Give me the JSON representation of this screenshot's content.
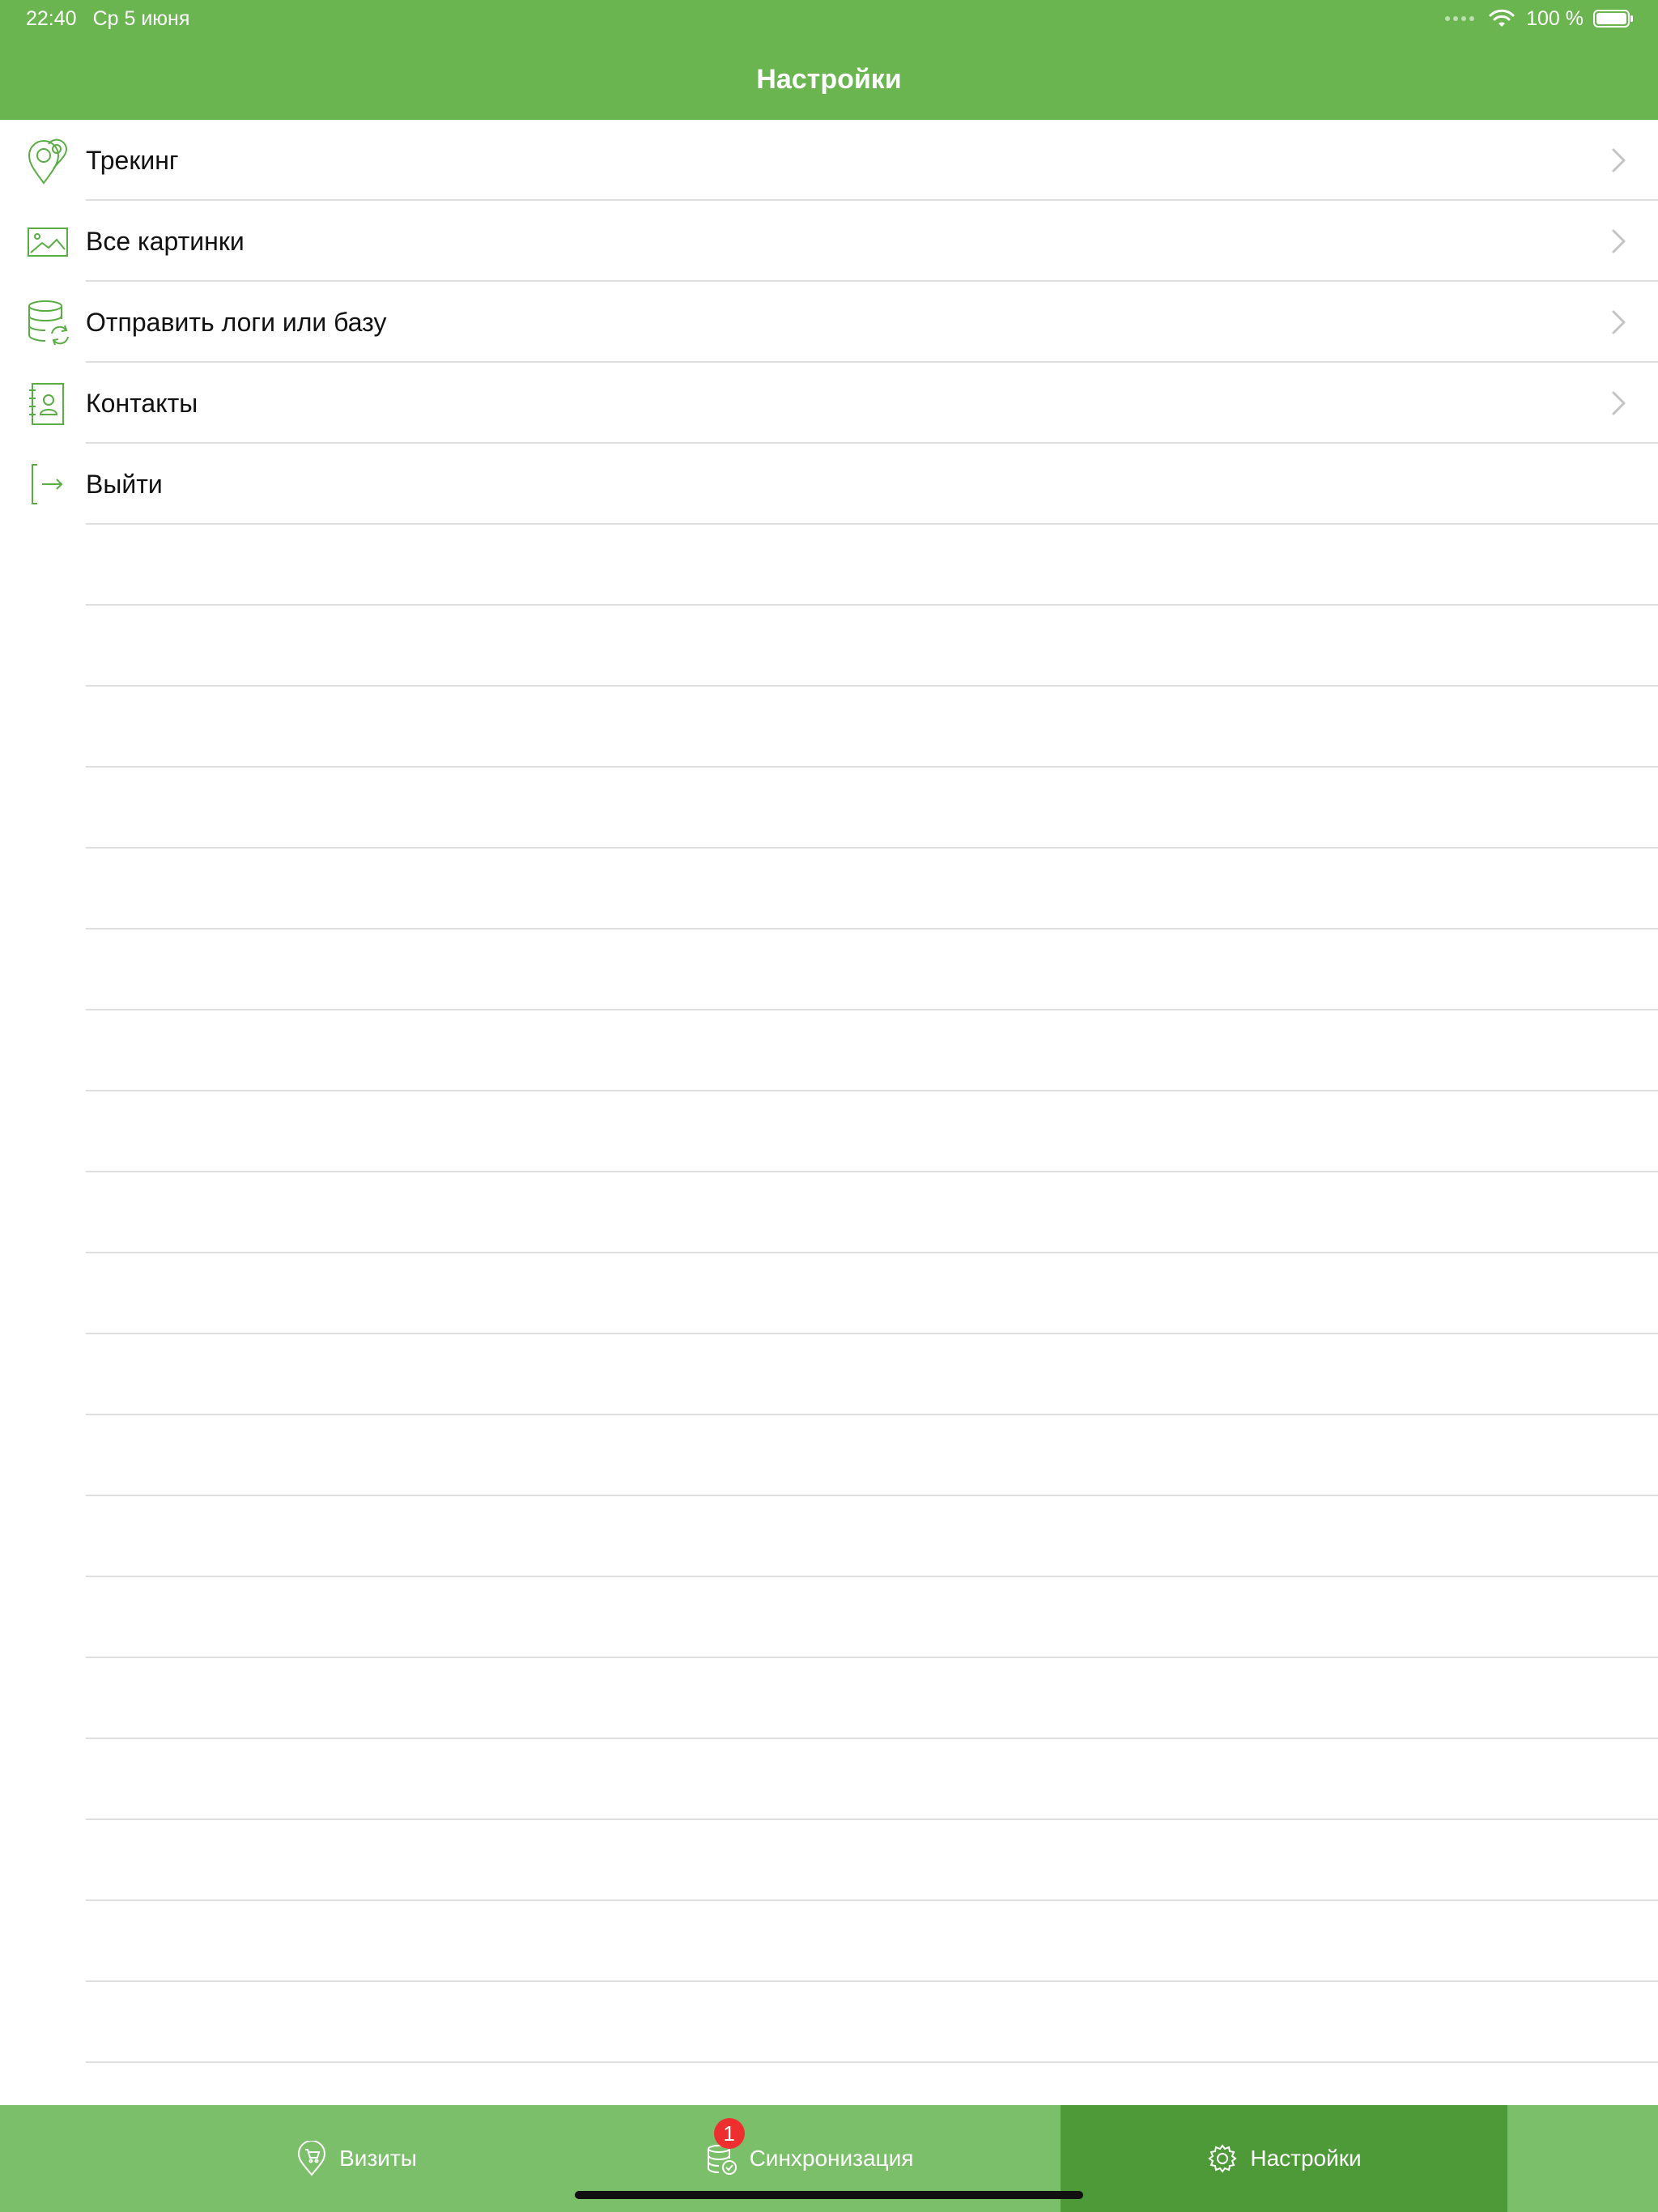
{
  "status_bar": {
    "time": "22:40",
    "date": "Ср 5 июня",
    "battery": "100 %"
  },
  "header": {
    "title": "Настройки"
  },
  "settings": {
    "items": [
      {
        "label": "Трекинг",
        "icon": "location-pins-icon"
      },
      {
        "label": "Все картинки",
        "icon": "image-icon"
      },
      {
        "label": "Отправить логи или базу",
        "icon": "database-sync-icon"
      },
      {
        "label": "Контакты",
        "icon": "contacts-book-icon"
      },
      {
        "label": "Выйти",
        "icon": "logout-icon"
      }
    ]
  },
  "tabbar": {
    "tabs": [
      {
        "label": "Визиты",
        "icon": "map-pin-cart-icon"
      },
      {
        "label": "Синхронизация",
        "icon": "database-check-icon",
        "badge": "1"
      },
      {
        "label": "Настройки",
        "icon": "gear-icon"
      }
    ]
  },
  "colors": {
    "header": "#6ab550",
    "tabbar": "#7cbf6a",
    "tab_active": "#4f9a38",
    "icon_green": "#5aad45",
    "badge": "#ee2f2f"
  }
}
